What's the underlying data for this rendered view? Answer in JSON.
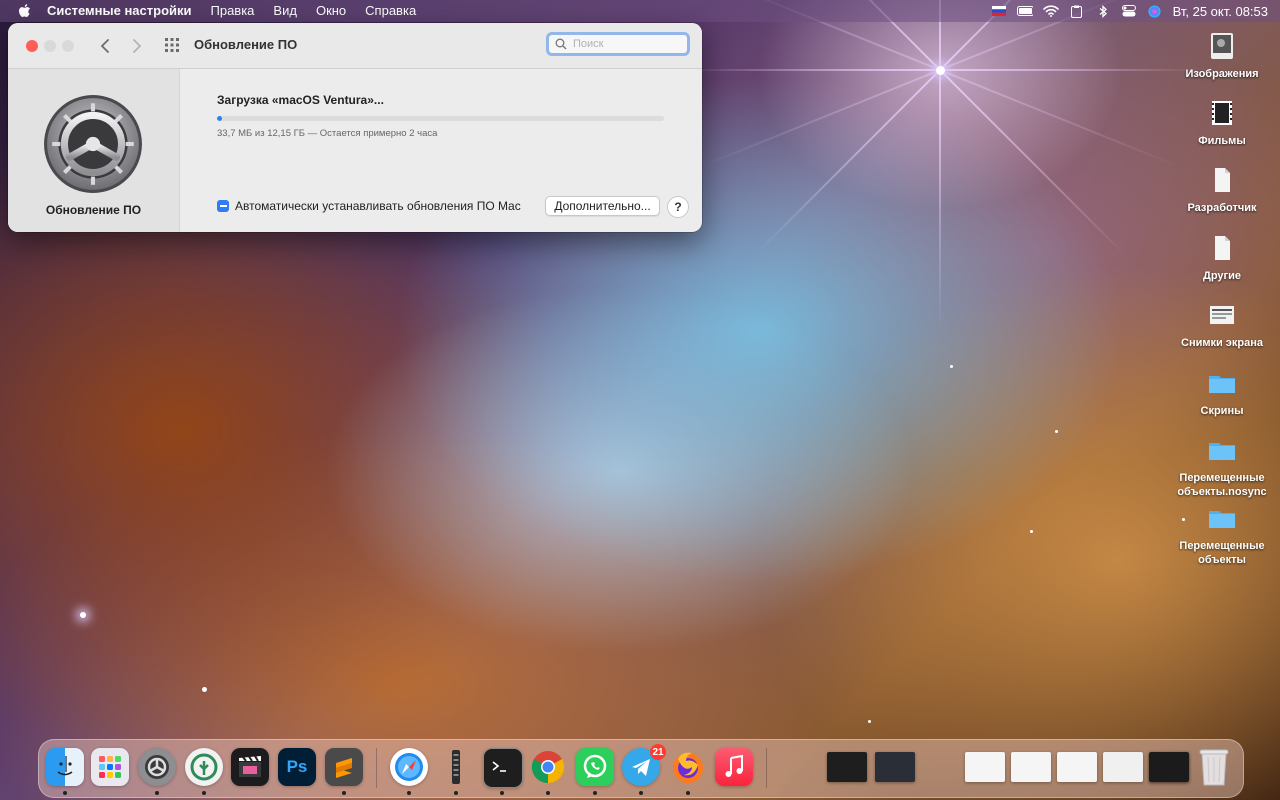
{
  "menubar": {
    "app_name": "Системные настройки",
    "menus": [
      "Правка",
      "Вид",
      "Окно",
      "Справка"
    ],
    "clock": "Вт, 25 окт.  08:53",
    "status_icons": [
      "flag-ru-icon",
      "battery-icon",
      "wifi-icon",
      "clipboard-icon",
      "bluetooth-icon",
      "control-center-icon",
      "siri-icon"
    ]
  },
  "window": {
    "title": "Обновление ПО",
    "search": {
      "placeholder": "Поиск",
      "value": ""
    },
    "sidebar_label": "Обновление ПО",
    "download_title": "Загрузка «macOS Ventura»...",
    "progress_fraction": 0.0028,
    "status": "33,7 МБ из 12,15 ГБ — Остается примерно 2 часа",
    "auto_update_label": "Автоматически устанавливать обновления ПО Mac",
    "advanced_button": "Дополнительно...",
    "help_button": "?"
  },
  "desktop": {
    "items": [
      {
        "label": "Изображения",
        "icon": "photo-icon"
      },
      {
        "label": "Фильмы",
        "icon": "film-icon"
      },
      {
        "label": "Разработчик",
        "icon": "document-icon"
      },
      {
        "label": "Другие",
        "icon": "document-icon"
      },
      {
        "label": "Снимки экрана",
        "icon": "screenshot-icon"
      },
      {
        "label": "Скрины",
        "icon": "folder-icon"
      },
      {
        "label": "Перемещенные объекты.nosync",
        "icon": "folder-icon"
      },
      {
        "label": "Перемещенные объекты",
        "icon": "folder-icon"
      }
    ]
  },
  "dock": {
    "apps": [
      {
        "name": "Finder",
        "icon": "finder-icon",
        "color": "#3ea7f5"
      },
      {
        "name": "Launchpad",
        "icon": "launchpad-icon",
        "color": "#e8e8ee"
      },
      {
        "name": "System Preferences",
        "icon": "settings-icon",
        "color": "#8d8d92"
      },
      {
        "name": "Sourcetree",
        "icon": "sourcetree-icon",
        "color": "#f2f2f2"
      },
      {
        "name": "Final Cut Pro",
        "icon": "clapper-icon",
        "color": "#1c1c1e"
      },
      {
        "name": "Photoshop",
        "icon": "photoshop-icon",
        "color": "#001e36",
        "text": "Ps"
      },
      {
        "name": "Sublime Text",
        "icon": "sublime-icon",
        "color": "#4a4a4a"
      },
      {
        "name": "Safari",
        "icon": "safari-icon",
        "color": "#ffffff"
      },
      {
        "name": "Monitor",
        "icon": "bar-icon",
        "color": "#2c2c2e"
      },
      {
        "name": "Terminal",
        "icon": "terminal-icon",
        "color": "#1e1e1e"
      },
      {
        "name": "Chrome",
        "icon": "chrome-icon",
        "color": "#ffffff"
      },
      {
        "name": "WhatsApp",
        "icon": "whatsapp-icon",
        "color": "#2ccf5b"
      },
      {
        "name": "Telegram",
        "icon": "telegram-icon",
        "color": "#34a8e8",
        "badge": "21"
      },
      {
        "name": "Firefox",
        "icon": "firefox-icon",
        "color": "#ff7a1a"
      },
      {
        "name": "Music",
        "icon": "music-icon",
        "color": "#fa3c51"
      }
    ],
    "minimized": [
      {
        "name": "sublime-window",
        "color": "#1e1e1e"
      },
      {
        "name": "terminal-window",
        "color": "#2a2e36"
      },
      {
        "name": "music-window",
        "color": "#f5f5f5"
      },
      {
        "name": "sourcetree-window",
        "color": "#f5f5f5"
      },
      {
        "name": "safari-window",
        "color": "#f5f5f5"
      },
      {
        "name": "chrome-window",
        "color": "#f0f0f0"
      },
      {
        "name": "whatsapp-window",
        "color": "#f4f4f4"
      },
      {
        "name": "terminal-window-2",
        "color": "#1b1b1b"
      }
    ],
    "trash": {
      "name": "Trash",
      "icon": "trash-icon"
    }
  },
  "colors": {
    "accent": "#2f7cf6",
    "close": "#fe5f57"
  }
}
